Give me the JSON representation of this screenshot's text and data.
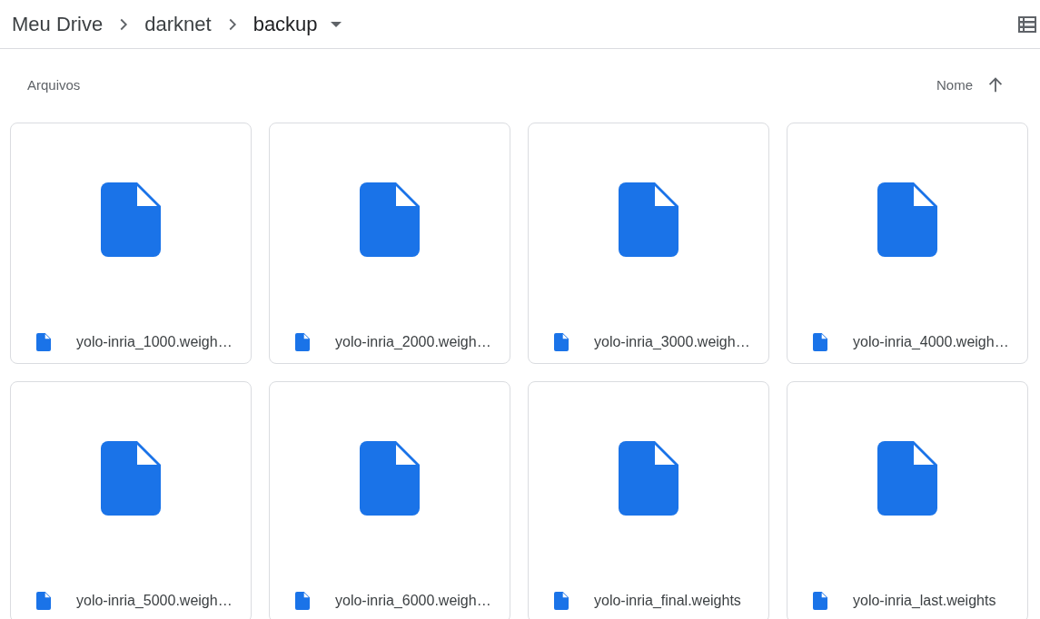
{
  "breadcrumbs": [
    {
      "label": "Meu Drive",
      "current": false
    },
    {
      "label": "darknet",
      "current": false
    },
    {
      "label": "backup",
      "current": true
    }
  ],
  "section_title": "Arquivos",
  "sort": {
    "label": "Nome"
  },
  "files": [
    {
      "name": "yolo-inria_1000.weigh…"
    },
    {
      "name": "yolo-inria_2000.weigh…"
    },
    {
      "name": "yolo-inria_3000.weigh…"
    },
    {
      "name": "yolo-inria_4000.weigh…"
    },
    {
      "name": "yolo-inria_5000.weigh…"
    },
    {
      "name": "yolo-inria_6000.weigh…"
    },
    {
      "name": "yolo-inria_final.weights"
    },
    {
      "name": "yolo-inria_last.weights"
    }
  ]
}
